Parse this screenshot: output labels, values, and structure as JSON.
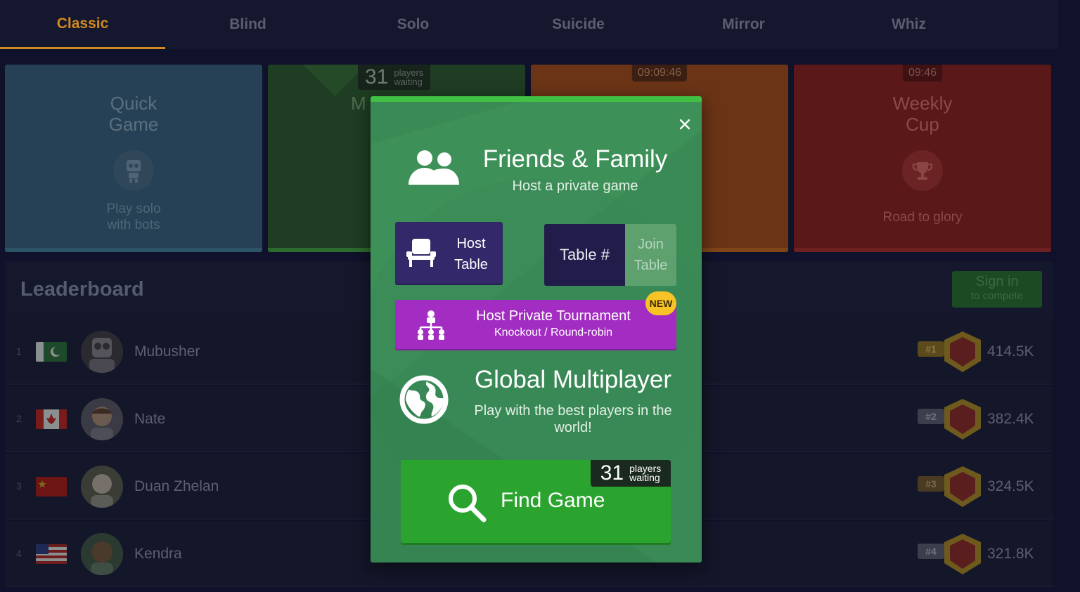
{
  "tabs": [
    {
      "label": "Classic",
      "active": true
    },
    {
      "label": "Blind"
    },
    {
      "label": "Solo"
    },
    {
      "label": "Suicide"
    },
    {
      "label": "Mirror"
    },
    {
      "label": "Whiz"
    }
  ],
  "cards": {
    "quick": {
      "title1": "Quick",
      "title2": "Game",
      "sub1": "Play solo",
      "sub2": "with bots"
    },
    "multi": {
      "players_count": "31",
      "players_label1": "players",
      "players_label2": "waiting",
      "title_fragment": "M"
    },
    "tournament": {
      "timer": "09:09:46"
    },
    "weekly": {
      "timer": "09:46",
      "title1": "Weekly",
      "title2": "Cup",
      "sub": "Road to glory"
    }
  },
  "leaderboard": {
    "title": "Leaderboard",
    "signin_line1": "Sign in",
    "signin_line2": "to compete",
    "rows": [
      {
        "rank": "1",
        "name": "Mubusher",
        "rank_chip": "#1",
        "score": "414.5K",
        "flag": "pakistan"
      },
      {
        "rank": "2",
        "name": "Nate",
        "rank_chip": "#2",
        "score": "382.4K",
        "flag": "canada"
      },
      {
        "rank": "3",
        "name": "Duan Zhelan",
        "rank_chip": "#3",
        "score": "324.5K",
        "flag": "china"
      },
      {
        "rank": "4",
        "name": "Kendra",
        "rank_chip": "#4",
        "score": "321.8K",
        "flag": "usa"
      }
    ]
  },
  "modal": {
    "close_icon": "close-icon",
    "friends": {
      "title": "Friends & Family",
      "subtitle": "Host a private game",
      "icon": "people-icon"
    },
    "host_table": {
      "line1": "Host",
      "line2": "Table",
      "icon": "chair-icon"
    },
    "table_input": {
      "placeholder": "Table #"
    },
    "join_table": {
      "line1": "Join",
      "line2": "Table"
    },
    "tournament": {
      "title": "Host Private Tournament",
      "subtitle": "Knockout / Round-robin",
      "badge": "NEW",
      "icon": "bracket-icon"
    },
    "global": {
      "title": "Global Multiplayer",
      "subtitle1": "Play with the best players in the",
      "subtitle2": "world!",
      "icon": "globe-icon"
    },
    "find_game": {
      "label": "Find Game",
      "players_count": "31",
      "players_label1": "players",
      "players_label2": "waiting",
      "icon": "search-icon"
    },
    "colors": {
      "accent": "#41c043",
      "modal_bg": "#3a8a55",
      "host_bg": "#33296a",
      "tournament_bg": "#a32cc2",
      "find_bg": "#2ba42f",
      "badge": "#f7c327"
    }
  }
}
